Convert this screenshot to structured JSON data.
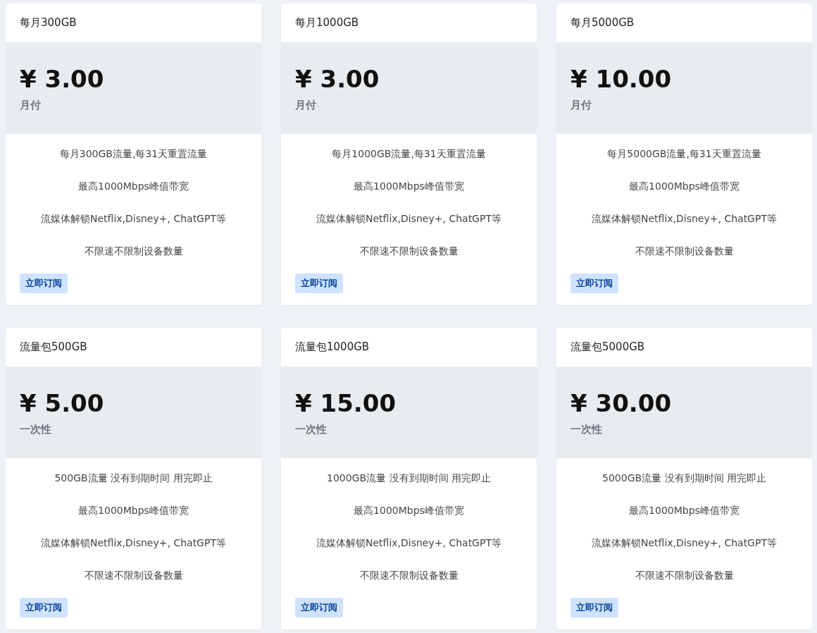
{
  "plans": [
    {
      "name": "每月300GB",
      "price": "¥ 3.00",
      "period": "月付",
      "features": [
        "每月300GB流量,每31天重置流量",
        "最高1000Mbps峰值带宽",
        "流媒体解锁Netflix,Disney+, ChatGPT等",
        "不限速不限制设备数量"
      ],
      "button": "立即订阅"
    },
    {
      "name": "每月1000GB",
      "price": "¥ 3.00",
      "period": "月付",
      "features": [
        "每月1000GB流量,每31天重置流量",
        "最高1000Mbps峰值带宽",
        "流媒体解锁Netflix,Disney+, ChatGPT等",
        "不限速不限制设备数量"
      ],
      "button": "立即订阅"
    },
    {
      "name": "每月5000GB",
      "price": "¥ 10.00",
      "period": "月付",
      "features": [
        "每月5000GB流量,每31天重置流量",
        "最高1000Mbps峰值带宽",
        "流媒体解锁Netflix,Disney+, ChatGPT等",
        "不限速不限制设备数量"
      ],
      "button": "立即订阅"
    },
    {
      "name": "流量包500GB",
      "price": "¥ 5.00",
      "period": "一次性",
      "features": [
        "500GB流量 没有到期时间 用完即止",
        "最高1000Mbps峰值带宽",
        "流媒体解锁Netflix,Disney+, ChatGPT等",
        "不限速不限制设备数量"
      ],
      "button": "立即订阅"
    },
    {
      "name": "流量包1000GB",
      "price": "¥ 15.00",
      "period": "一次性",
      "features": [
        "1000GB流量 没有到期时间 用完即止",
        "最高1000Mbps峰值带宽",
        "流媒体解锁Netflix,Disney+, ChatGPT等",
        "不限速不限制设备数量"
      ],
      "button": "立即订阅"
    },
    {
      "name": "流量包5000GB",
      "price": "¥ 30.00",
      "period": "一次性",
      "features": [
        "5000GB流量 没有到期时间 用完即止",
        "最高1000Mbps峰值带宽",
        "流媒体解锁Netflix,Disney+, ChatGPT等",
        "不限速不限制设备数量"
      ],
      "button": "立即订阅"
    }
  ]
}
